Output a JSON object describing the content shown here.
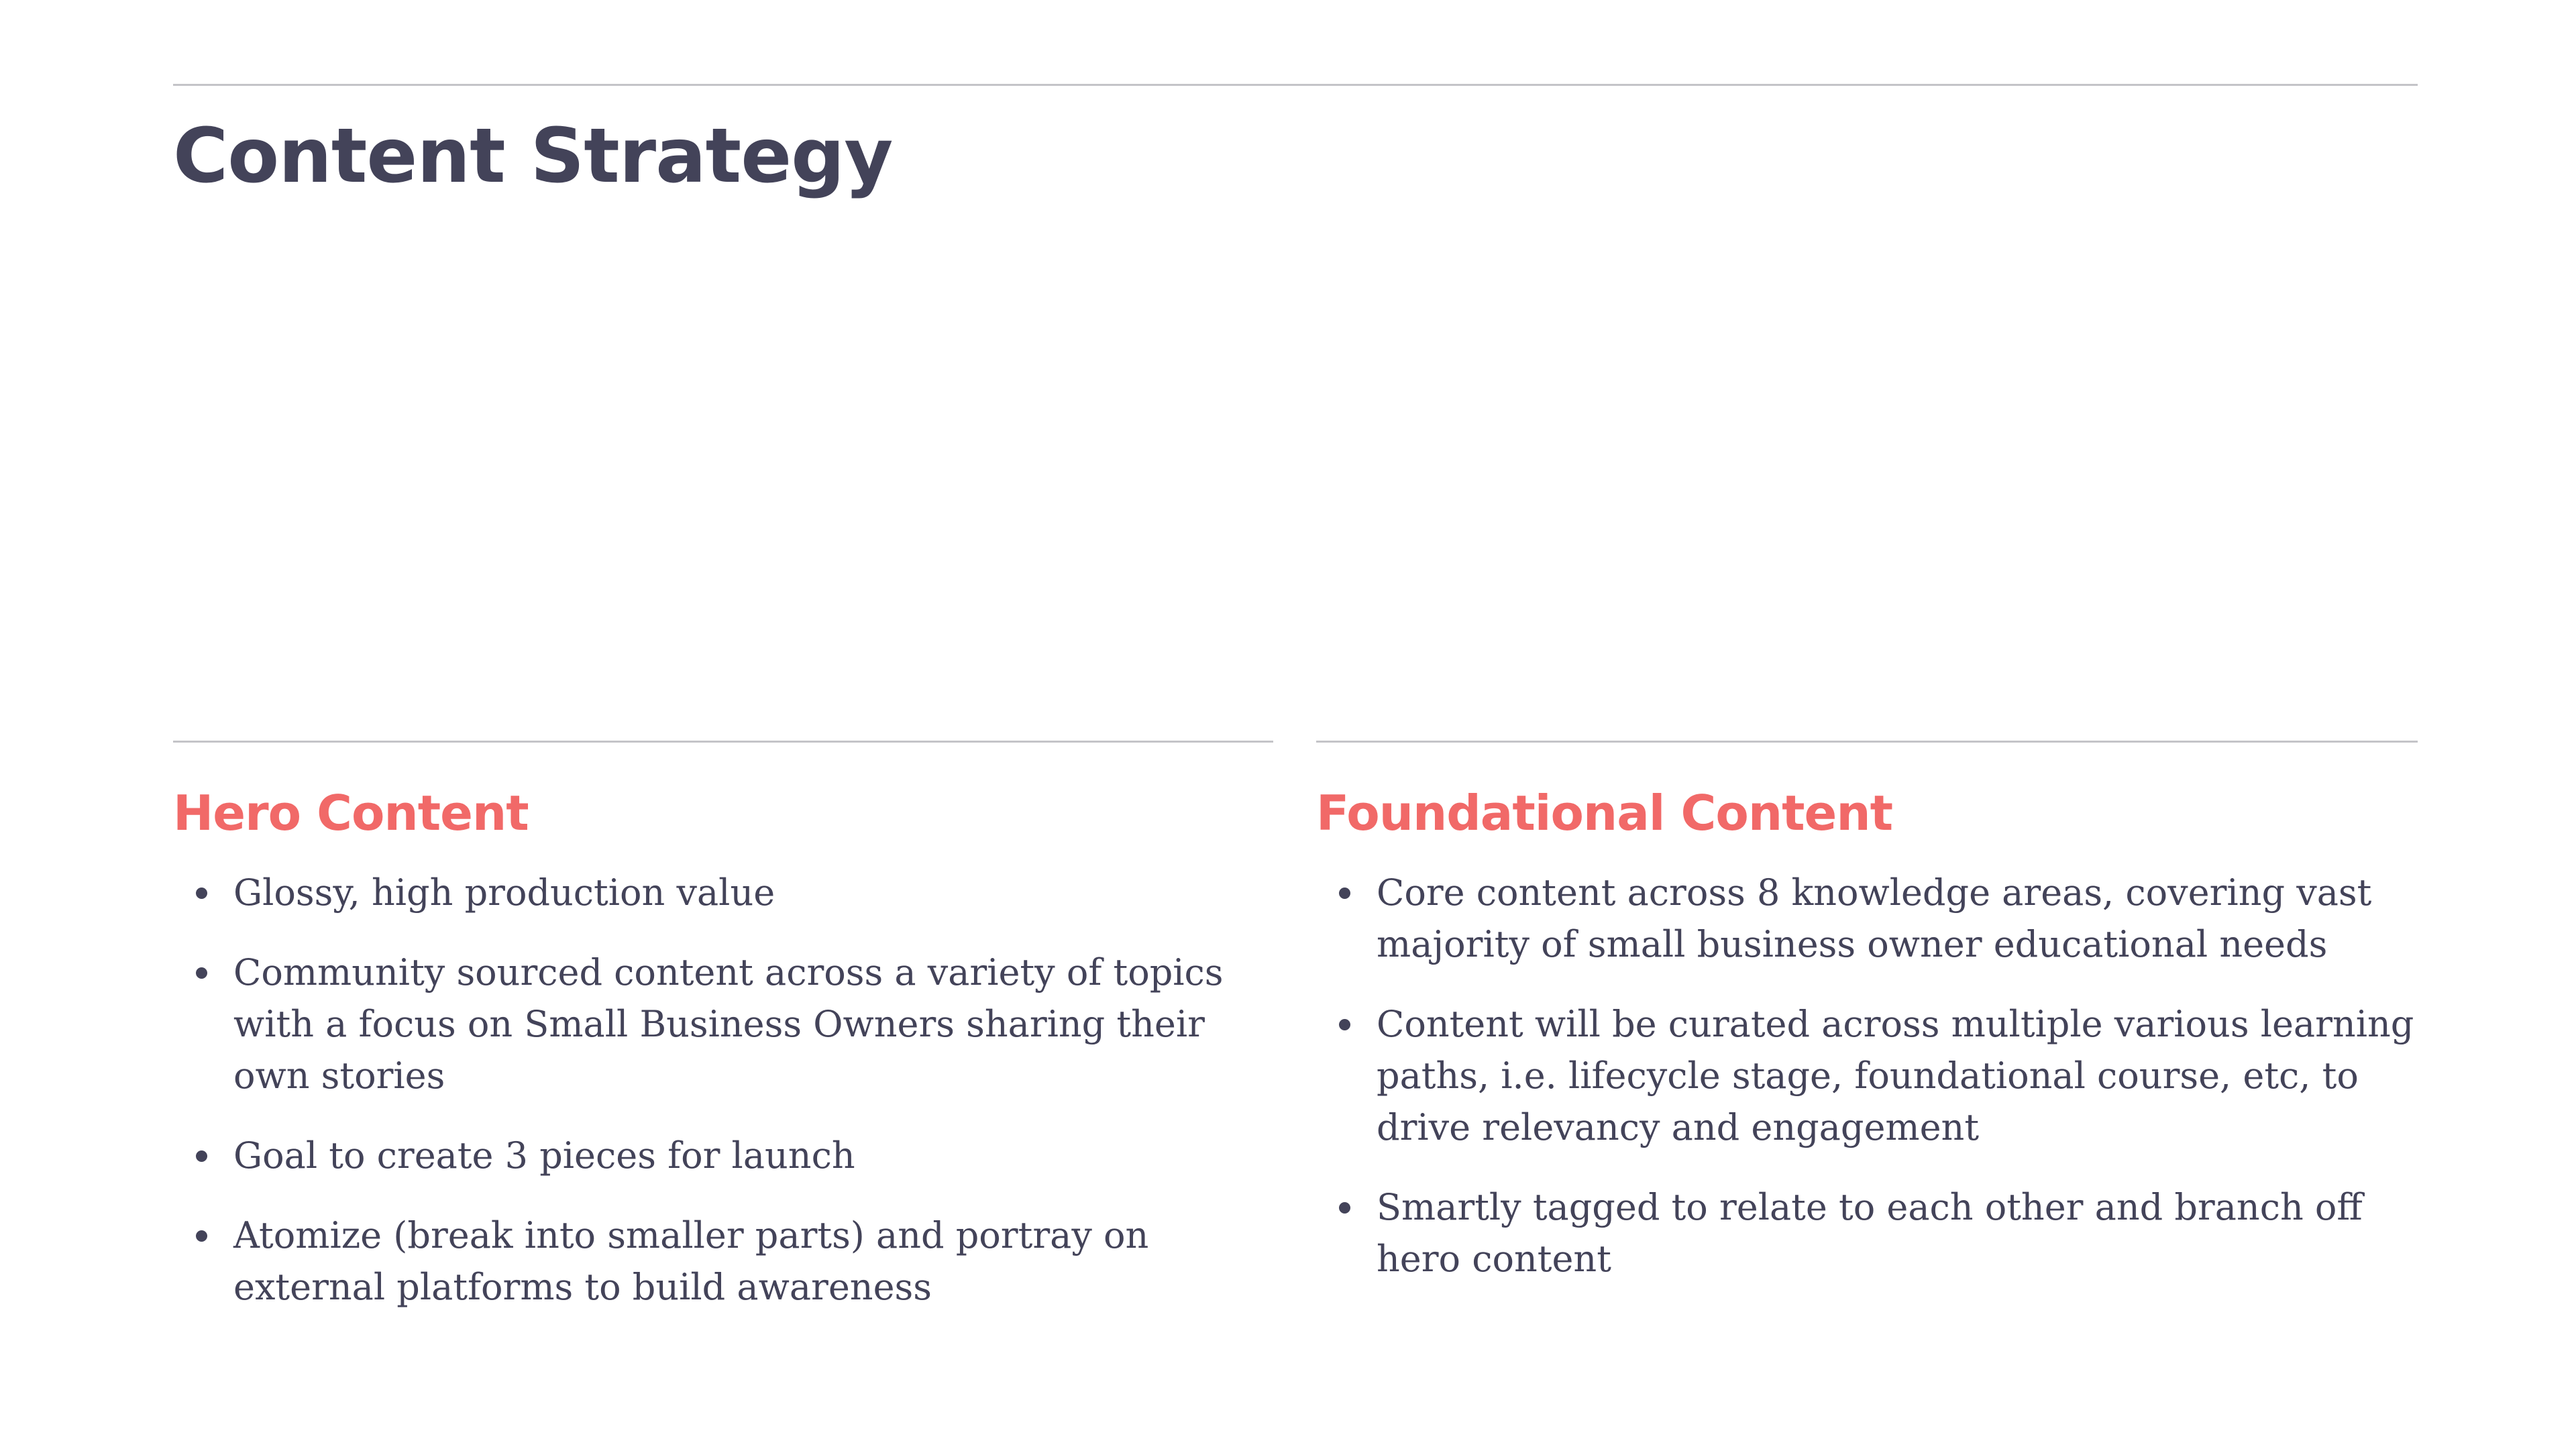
{
  "slide": {
    "title": "Content Strategy"
  },
  "left_column": {
    "heading": "Hero Content",
    "bullets": [
      "Glossy, high production value",
      "Community sourced content across a variety of topics with a focus on Small Business Owners sharing their own stories",
      "Goal to create 3 pieces for launch",
      "Atomize (break into smaller parts) and portray on external platforms to build awareness"
    ]
  },
  "right_column": {
    "heading": "Foundational Content",
    "bullets": [
      "Core content across 8 knowledge areas, covering vast majority of small business owner educational needs",
      "Content will be curated across multiple various learning paths, i.e. lifecycle stage, foundational course, etc, to drive relevancy and engagement",
      "Smartly tagged to relate to each other and branch off hero content"
    ]
  },
  "colors": {
    "title": "#434359",
    "accent_heading": "#f16968",
    "body_text": "#434359",
    "rule": "#c4c4c8"
  }
}
